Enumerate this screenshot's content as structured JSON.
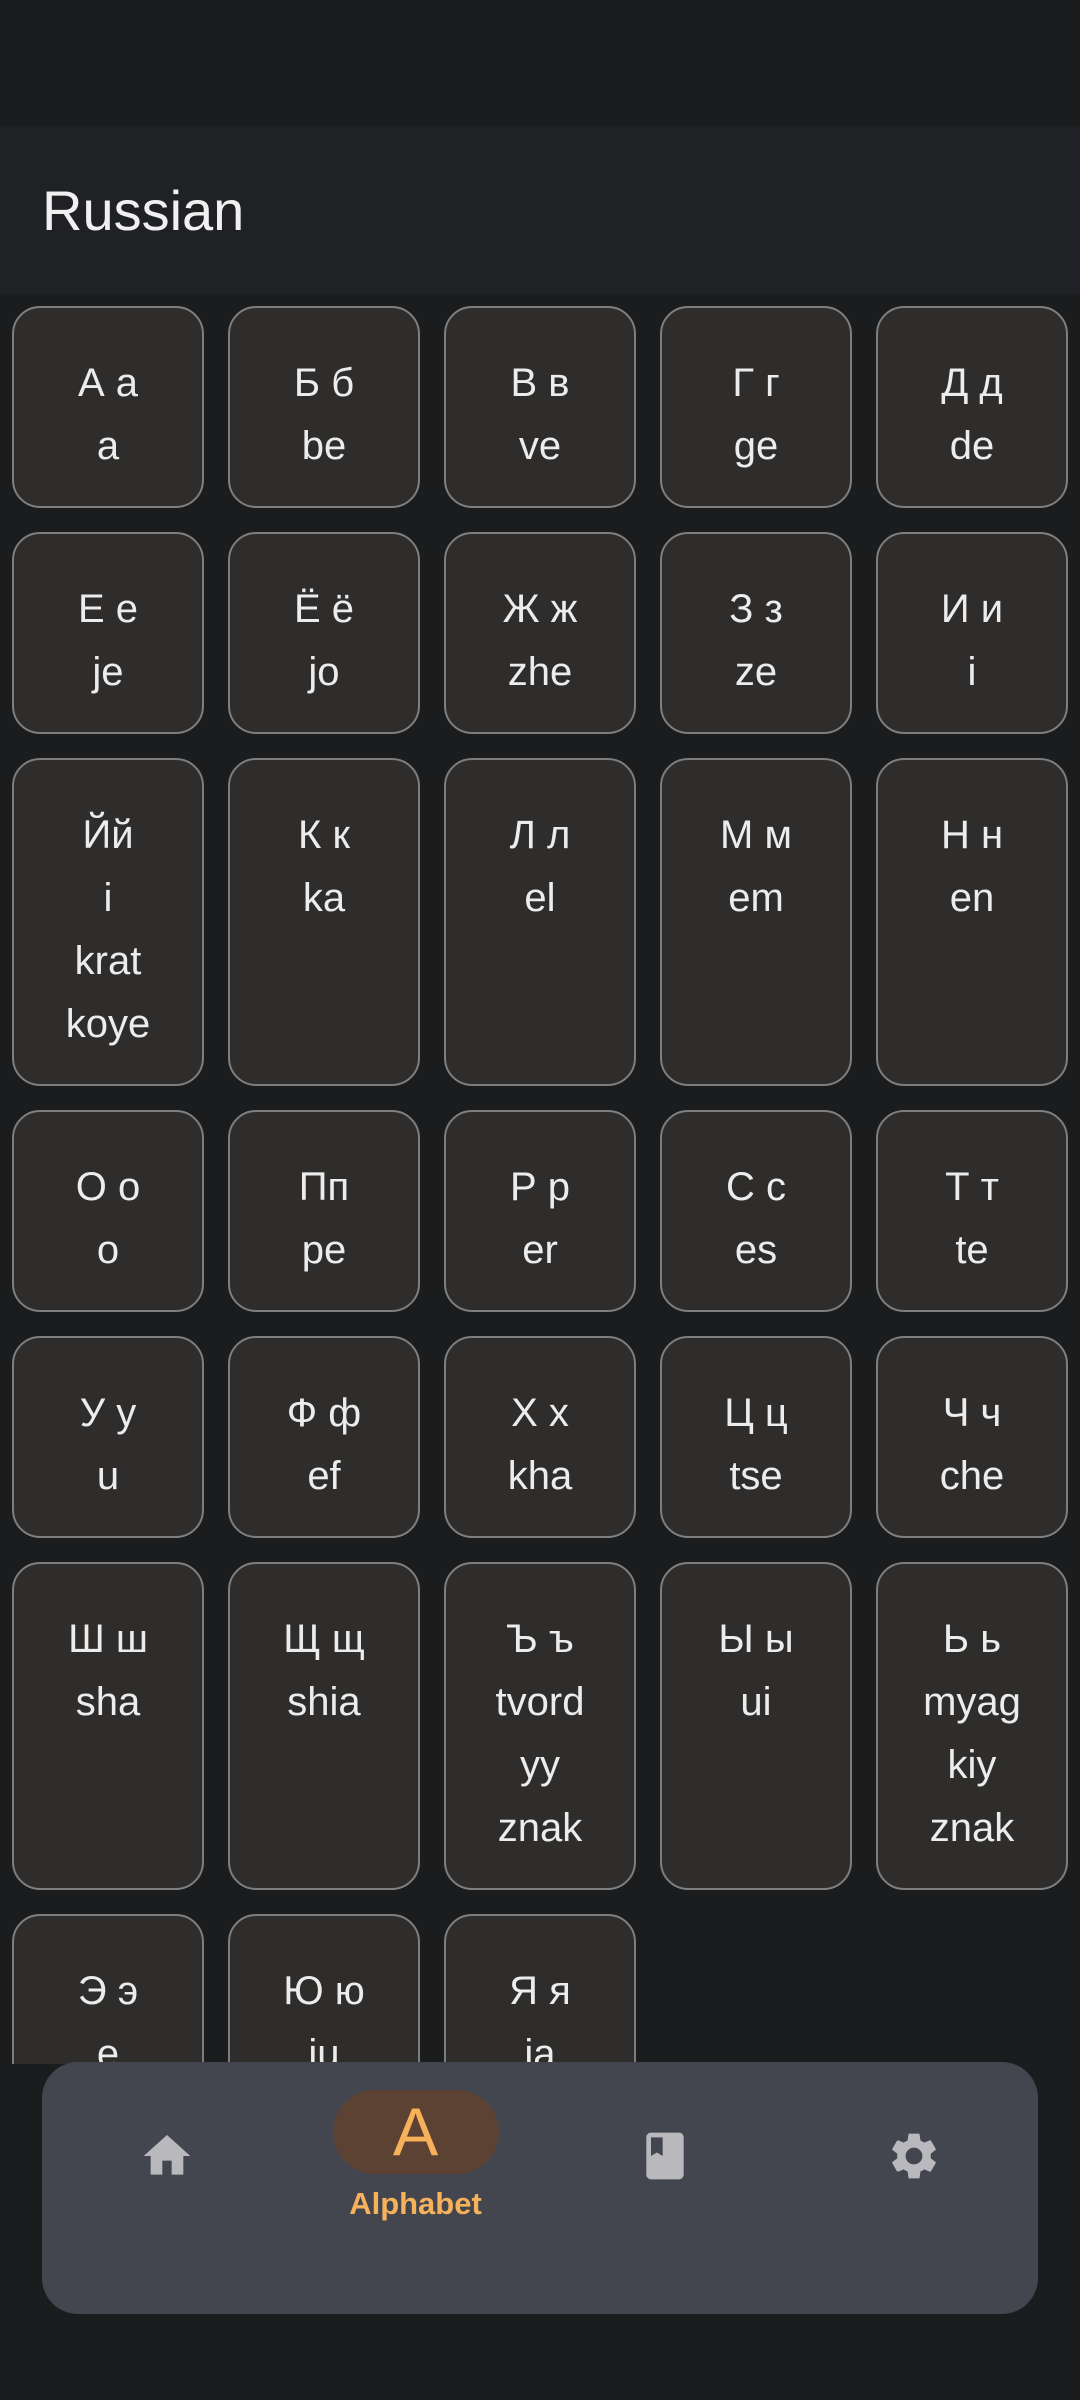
{
  "app_bar": {
    "title": "Russian"
  },
  "letters": [
    {
      "lines": [
        "А а",
        "a"
      ]
    },
    {
      "lines": [
        "Б б",
        "be"
      ]
    },
    {
      "lines": [
        "В в",
        "ve"
      ]
    },
    {
      "lines": [
        "Г г",
        "ge"
      ]
    },
    {
      "lines": [
        "Д д",
        "de"
      ]
    },
    {
      "lines": [
        "Е е",
        "je"
      ]
    },
    {
      "lines": [
        "Ё ё",
        "jo"
      ]
    },
    {
      "lines": [
        "Ж ж",
        "zhe"
      ]
    },
    {
      "lines": [
        "З з",
        "ze"
      ]
    },
    {
      "lines": [
        "И и",
        "i"
      ]
    },
    {
      "lines": [
        "Йй",
        "i",
        "krat",
        "koye"
      ]
    },
    {
      "lines": [
        "К к",
        "ka"
      ]
    },
    {
      "lines": [
        "Л л",
        "el"
      ]
    },
    {
      "lines": [
        "М м",
        "em"
      ]
    },
    {
      "lines": [
        "Н н",
        "en"
      ]
    },
    {
      "lines": [
        "О о",
        "o"
      ]
    },
    {
      "lines": [
        "Пп",
        "pe"
      ]
    },
    {
      "lines": [
        "Р р",
        "er"
      ]
    },
    {
      "lines": [
        "С с",
        "es"
      ]
    },
    {
      "lines": [
        "Т т",
        "te"
      ]
    },
    {
      "lines": [
        "У у",
        "u"
      ]
    },
    {
      "lines": [
        "Ф ф",
        "ef"
      ]
    },
    {
      "lines": [
        "Х х",
        "kha"
      ]
    },
    {
      "lines": [
        "Ц ц",
        "tse"
      ]
    },
    {
      "lines": [
        "Ч ч",
        "che"
      ]
    },
    {
      "lines": [
        "Ш ш",
        "sha"
      ]
    },
    {
      "lines": [
        "Щ щ",
        "shia"
      ]
    },
    {
      "lines": [
        "Ъ ъ",
        "tvord",
        "yy",
        "znak"
      ]
    },
    {
      "lines": [
        "Ы ы",
        "ui"
      ]
    },
    {
      "lines": [
        "Ь ь",
        "myag",
        "kiy",
        "znak"
      ]
    },
    {
      "lines": [
        "Э э",
        "e"
      ]
    },
    {
      "lines": [
        "Ю ю",
        "ju"
      ]
    },
    {
      "lines": [
        "Я я",
        "ja"
      ]
    }
  ],
  "bottom_nav": {
    "items": [
      {
        "name": "home",
        "icon": "home-icon"
      },
      {
        "name": "alphabet",
        "icon": "alphabet-icon",
        "glyph": "A",
        "label": "Alphabet",
        "selected": true
      },
      {
        "name": "book",
        "icon": "book-icon"
      },
      {
        "name": "settings",
        "icon": "gear-icon"
      }
    ]
  },
  "colors": {
    "background": "#1b1c1e",
    "app_bar": "#202124",
    "tile": "#2e2d2c",
    "tile_border": "#7e7e7e",
    "nav_bar": "#44464f",
    "accent": "#f6b15a",
    "accent_pill": "#5c4232",
    "icon_inactive": "#b9b9bd"
  }
}
